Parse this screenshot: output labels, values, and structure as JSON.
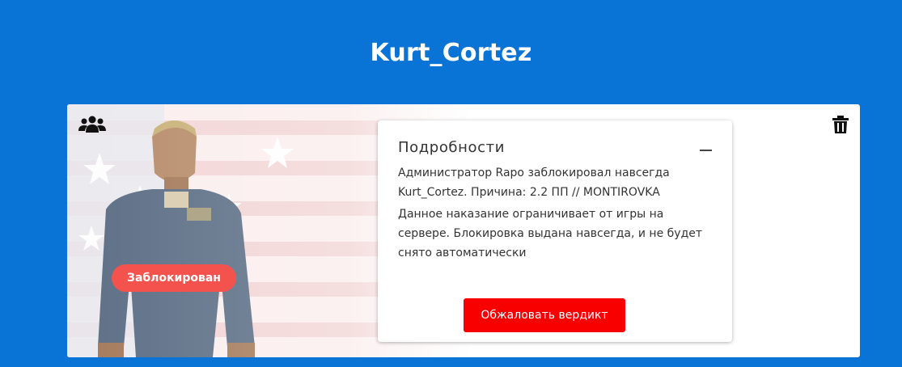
{
  "player": {
    "name": "Kurt_Cortez"
  },
  "status_badge": {
    "label": "Заблокирован"
  },
  "details": {
    "heading": "Подробности",
    "ban_text": "Администратор Rapo заблокировал навсегда Kurt_Cortez. Причина: 2.2 ПП // MONTIROVKA",
    "effect_text": "Данное наказание ограничивает от игры на сервере. Блокировка выдана навсегда, и не будет снято автоматически",
    "appeal_button": "Обжаловать вердикт"
  },
  "icons": {
    "group": "users-icon",
    "delete": "trash-icon",
    "collapse": "minus-icon"
  },
  "colors": {
    "background": "#0a74d6",
    "badge": "#f4524d",
    "appeal": "#f80000"
  }
}
